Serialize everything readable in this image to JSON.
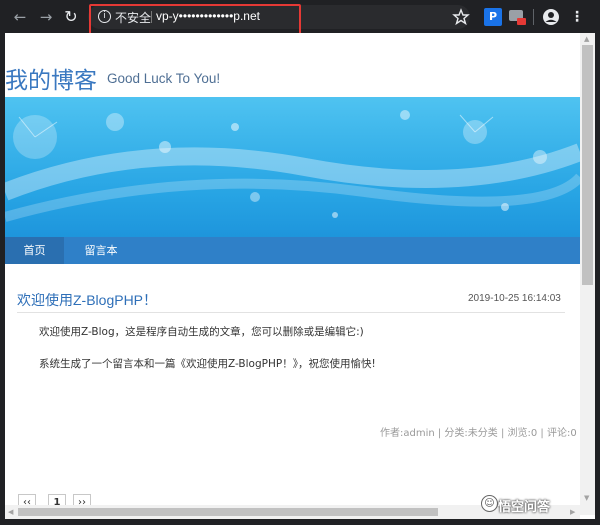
{
  "browser": {
    "security_label": "不安全",
    "url": "vp-y•••••••••••••p.net",
    "ext_p_label": "P"
  },
  "site": {
    "title": "我的博客",
    "subtitle": "Good Luck To You!"
  },
  "nav": {
    "items": [
      "首页",
      "留言本"
    ]
  },
  "post": {
    "title": "欢迎使用Z-BlogPHP！",
    "date": "2019-10-25 16:14:03",
    "paragraphs": [
      "欢迎使用Z-Blog，这是程序自动生成的文章，您可以删除或是编辑它:)",
      "系统生成了一个留言本和一篇《欢迎使用Z-BlogPHP！》，祝您使用愉快!"
    ],
    "meta": "作者:admin | 分类:未分类 | 浏览:0 | 评论:0"
  },
  "pagination": {
    "prev": "‹‹",
    "current": "1",
    "next": "››"
  },
  "watermark": {
    "text": "悟空问答"
  },
  "colors": {
    "accent": "#2f80c8",
    "highlight": "#e53935",
    "title": "#3a78c0"
  }
}
